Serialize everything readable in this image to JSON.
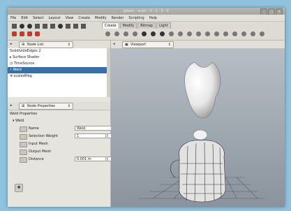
{
  "window": {
    "title": "gleam · anim · 5 · 1 · 0 · 0"
  },
  "menu": [
    "File",
    "Edit",
    "Select",
    "Layout",
    "View",
    "Create",
    "Modify",
    "Render",
    "Scripting",
    "Help"
  ],
  "tabs": [
    "Create",
    "Modify",
    "Bitmap",
    "Light"
  ],
  "node_list": {
    "combo_label": "Node List",
    "items": [
      "SubdivideEdges 2",
      "Surface Shader",
      "TimeSource",
      "Weld",
      "scaledHeg"
    ],
    "selected_index": 3
  },
  "node_properties": {
    "combo_label": "Node Properties",
    "section_title": "Weld Properties",
    "group_label": "Weld",
    "rows": [
      {
        "name": "Name",
        "value": "Weld"
      },
      {
        "name": "Selection Weight",
        "value": "1"
      },
      {
        "name": "Input Mesh",
        "value": ""
      },
      {
        "name": "Output Mesh",
        "value": ""
      },
      {
        "name": "Distance",
        "value": "0.001 m"
      }
    ]
  },
  "viewport": {
    "label": "Viewport"
  },
  "colors": {
    "selection": "#3b6ea5",
    "viewport_top": "#b9c0c7",
    "viewport_bottom": "#8a939d"
  }
}
